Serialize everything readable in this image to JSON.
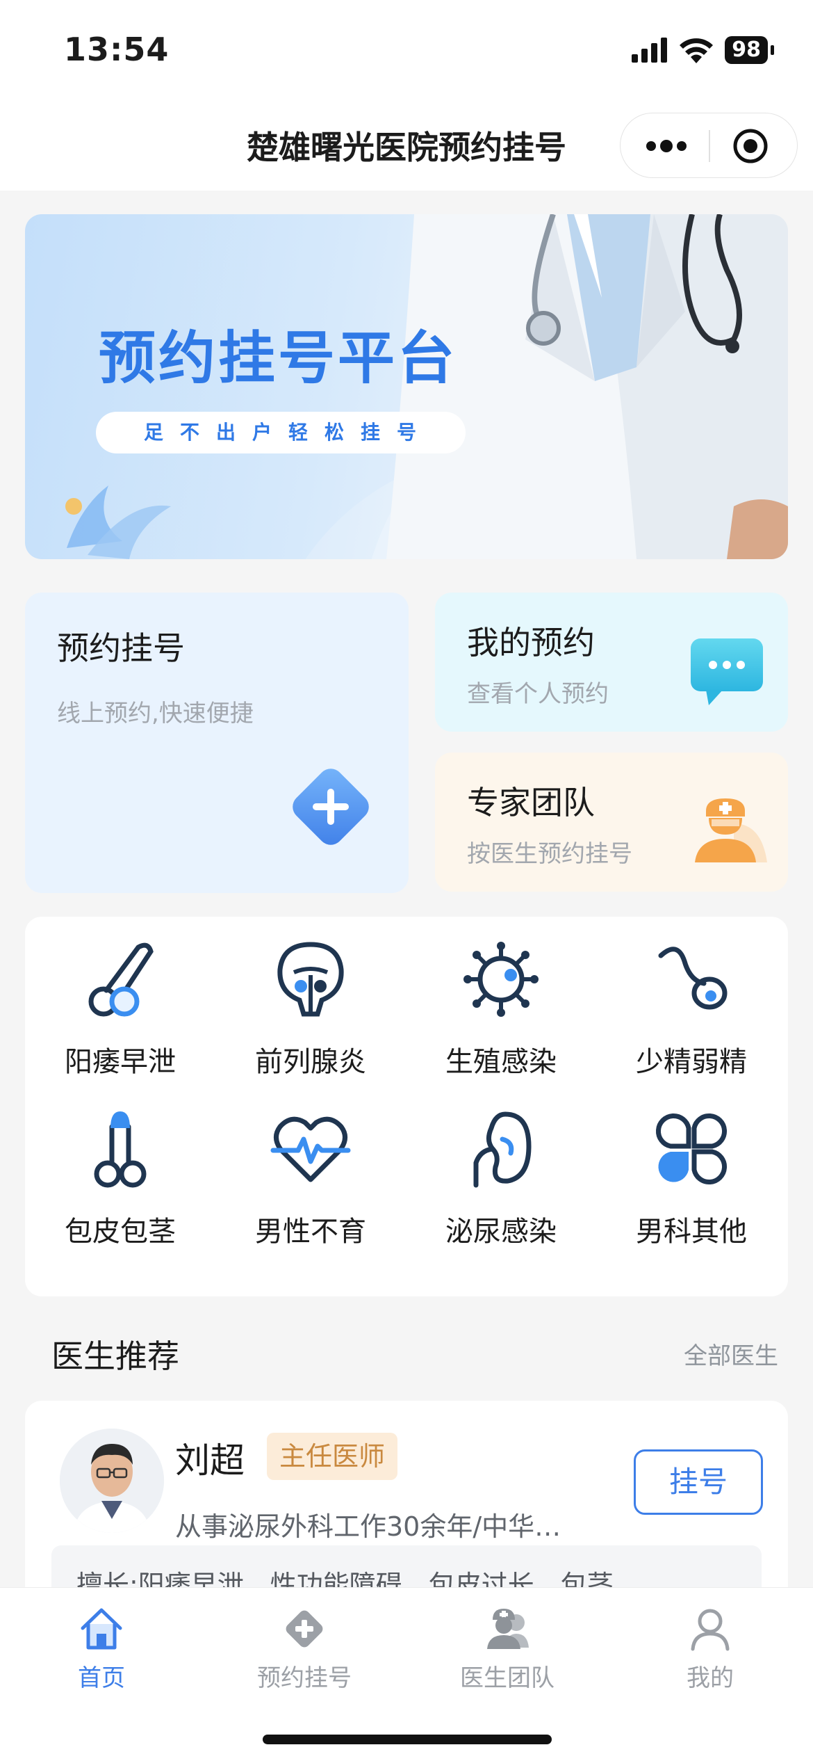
{
  "status": {
    "time": "13:54",
    "battery": "98"
  },
  "nav": {
    "title": "楚雄曙光医院预约挂号"
  },
  "banner": {
    "title": "预约挂号平台",
    "subtitle": "足不出户轻松挂号"
  },
  "quick": {
    "book": {
      "title": "预约挂号",
      "subtitle": "线上预约,快速便捷"
    },
    "mine": {
      "title": "我的预约",
      "subtitle": "查看个人预约"
    },
    "team": {
      "title": "专家团队",
      "subtitle": "按医生预约挂号"
    }
  },
  "categories": [
    {
      "label": "阳痿早泄",
      "icon": "testis-icon"
    },
    {
      "label": "前列腺炎",
      "icon": "prostate-icon"
    },
    {
      "label": "生殖感染",
      "icon": "virus-icon"
    },
    {
      "label": "少精弱精",
      "icon": "sperm-icon"
    },
    {
      "label": "包皮包茎",
      "icon": "penis-icon"
    },
    {
      "label": "男性不育",
      "icon": "heart-pulse-icon"
    },
    {
      "label": "泌尿感染",
      "icon": "kidney-icon"
    },
    {
      "label": "男科其他",
      "icon": "clover-icon"
    }
  ],
  "doctors_section": {
    "title": "医生推荐",
    "more": "全部医生"
  },
  "doctor": {
    "name": "刘超",
    "badge": "主任医师",
    "desc": "从事泌尿外科工作30余年/中华…",
    "book_label": "挂号",
    "tags": "擅长:阳痿早泄、性功能障碍、包皮过长、包茎"
  },
  "tabs": [
    {
      "label": "首页",
      "icon": "home-icon",
      "active": true
    },
    {
      "label": "预约挂号",
      "icon": "medical-cross-icon",
      "active": false
    },
    {
      "label": "医生团队",
      "icon": "doctors-icon",
      "active": false
    },
    {
      "label": "我的",
      "icon": "user-icon",
      "active": false
    }
  ],
  "colors": {
    "accent": "#3d7ee8",
    "icon_dark": "#1f3550",
    "icon_blue": "#3a8ef0"
  }
}
